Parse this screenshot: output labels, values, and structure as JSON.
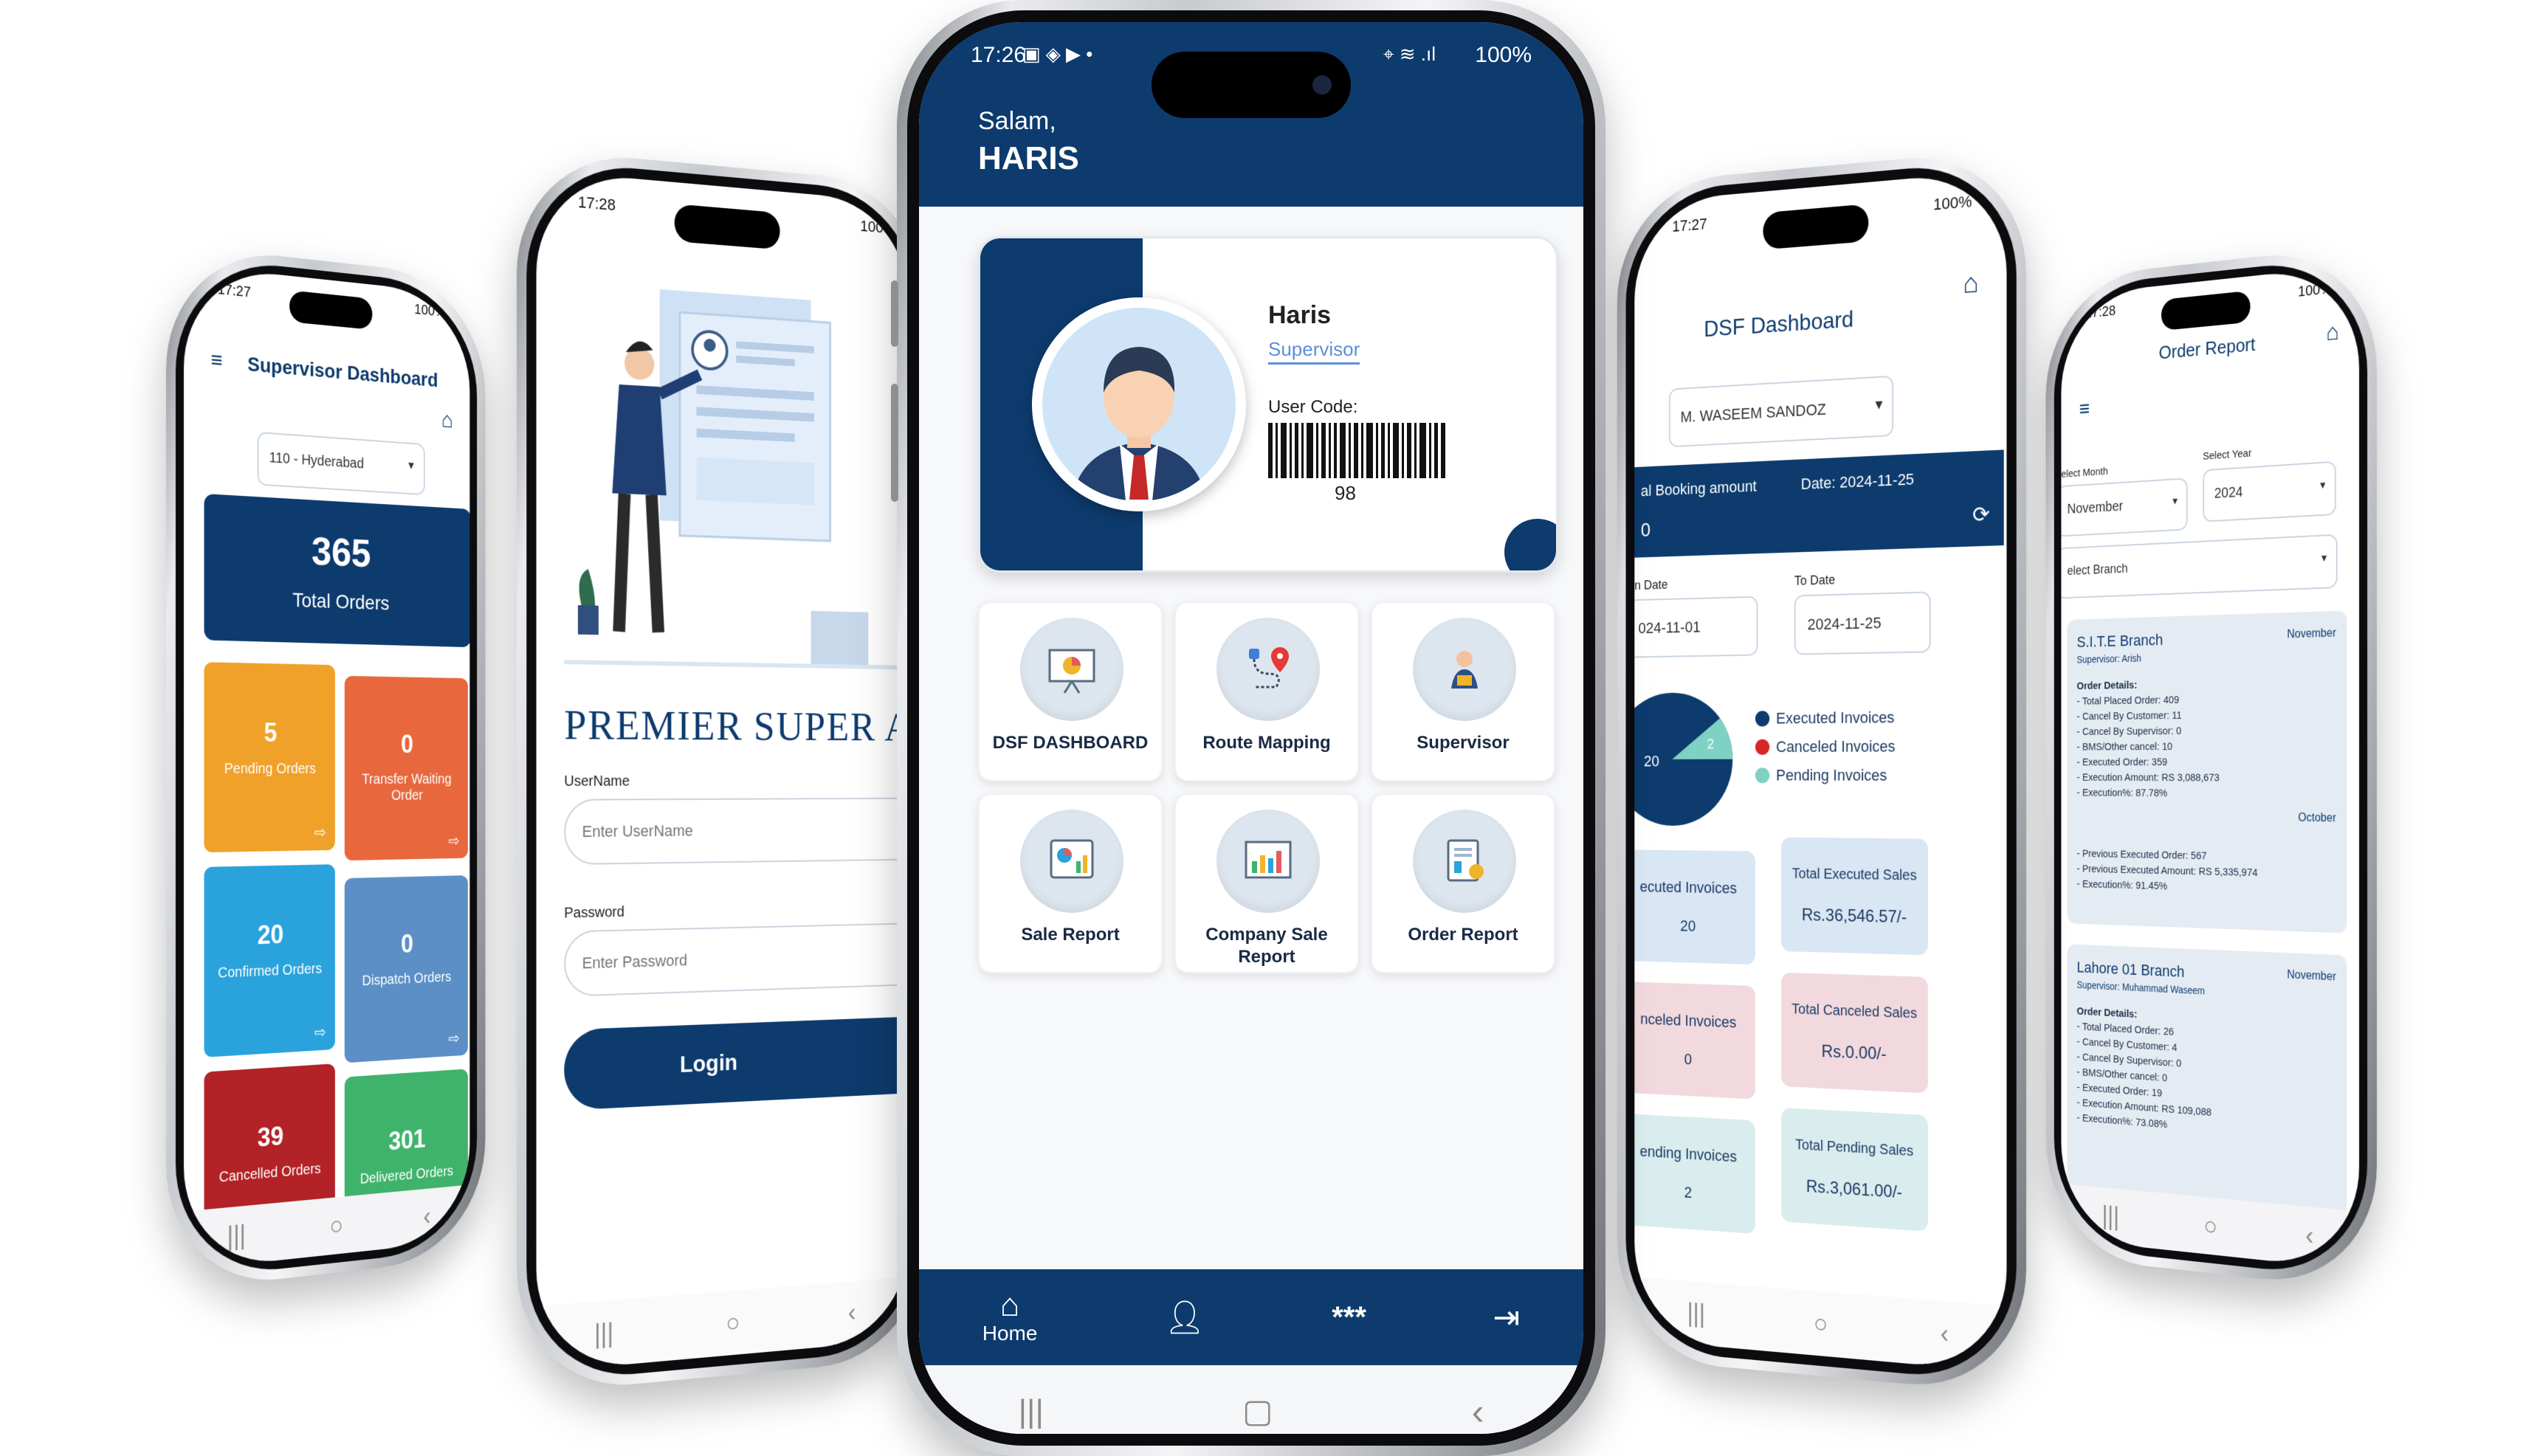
{
  "center": {
    "status": {
      "time": "17:26",
      "battery": "100%"
    },
    "greeting": "Salam,",
    "user_name": "HARIS",
    "profile": {
      "name": "Haris",
      "role": "Supervisor",
      "code_label": "User Code:",
      "code": "98"
    },
    "menu": [
      {
        "label": "DSF DASHBOARD"
      },
      {
        "label": "Route Mapping"
      },
      {
        "label": "Supervisor"
      },
      {
        "label": "Sale Report"
      },
      {
        "label": "Company Sale Report"
      },
      {
        "label": "Order Report"
      }
    ],
    "bottom_nav": {
      "home": "Home"
    }
  },
  "login": {
    "status": {
      "time": "17:28",
      "battery": "100"
    },
    "brand": "PREMIER SUPER AI",
    "username_label": "UserName",
    "username_placeholder": "Enter UserName",
    "password_label": "Password",
    "password_placeholder": "Enter Password",
    "login_button": "Login"
  },
  "supervisor": {
    "status": {
      "time": "17:27",
      "battery": "100%"
    },
    "title": "Supervisor Dashboard",
    "branch": "110 - Hyderabad",
    "total": {
      "value": "365",
      "label": "Total Orders"
    },
    "tiles": [
      {
        "value": "5",
        "label": "Pending Orders",
        "color": "#f0a12a"
      },
      {
        "value": "0",
        "label": "Transfer Waiting Order",
        "color": "#e8673d"
      },
      {
        "value": "20",
        "label": "Confirmed Orders",
        "color": "#2aa2dc"
      },
      {
        "value": "0",
        "label": "Dispatch Orders",
        "color": "#5b8fc6"
      },
      {
        "value": "39",
        "label": "Cancelled Orders",
        "color": "#b22226"
      },
      {
        "value": "301",
        "label": "Delivered Orders",
        "color": "#3fb36b"
      }
    ]
  },
  "dsf": {
    "status": {
      "time": "17:27",
      "battery": "100%"
    },
    "title": "DSF Dashboard",
    "salesman": "M. WASEEM SANDOZ",
    "booking_label": "al Booking amount",
    "booking_value": "0",
    "date_label": "Date: 2024-11-25",
    "from_label": "n Date",
    "from_value": "024-11-01",
    "to_label": "To Date",
    "to_value": "2024-11-25",
    "pie": {
      "value_left": "20",
      "value_right": "2"
    },
    "legend": [
      {
        "label": "Executed Invoices",
        "color": "#0d3b6e"
      },
      {
        "label": "Canceled Invoices",
        "color": "#d62828"
      },
      {
        "label": "Pending Invoices",
        "color": "#7fd1c4"
      }
    ],
    "stats": [
      {
        "left_label": "ecuted Invoices",
        "left_value": "20",
        "right_label": "Total Executed Sales",
        "right_value": "Rs.36,546.57/-",
        "color": "#d9e6f4"
      },
      {
        "left_label": "nceled Invoices",
        "left_value": "0",
        "right_label": "Total Canceled Sales",
        "right_value": "Rs.0.00/-",
        "color": "#f1d9de"
      },
      {
        "left_label": "ending Invoices",
        "left_value": "2",
        "right_label": "Total Pending Sales",
        "right_value": "Rs.3,061.00/-",
        "color": "#d9ecee"
      }
    ]
  },
  "order_report": {
    "status": {
      "time": "17:28",
      "battery": "100%"
    },
    "title": "Order Report",
    "month_label": "elect Month",
    "month_value": "November",
    "year_label": "Select Year",
    "year_value": "2024",
    "branch_label": "elect Branch",
    "branches": [
      {
        "name": "S.I.T.E Branch",
        "supervisor": "Supervisor: Arish",
        "month": "November",
        "details_title": "Order Details:",
        "lines": [
          "- Total Placed Order: 409",
          "- Cancel By Customer: 11",
          "- Cancel By Supervisor: 0",
          "- BMS/Other cancel: 10",
          "- Executed Order: 359",
          "- Execution Amount: RS 3,088,673",
          "- Execution%: 87.78%"
        ],
        "prev_month": "October",
        "prev_lines": [
          "- Previous Executed Order: 567",
          "- Previous Executed Amount: RS 5,335,974",
          "- Execution%: 91.45%"
        ]
      },
      {
        "name": "Lahore 01 Branch",
        "supervisor": "Supervisor: Muhammad Waseem",
        "month": "November",
        "details_title": "Order Details:",
        "lines": [
          "- Total Placed Order: 26",
          "- Cancel By Customer: 4",
          "- Cancel By Supervisor: 0",
          "- BMS/Other cancel: 0",
          "- Executed Order: 19",
          "- Execution Amount: RS 109,088",
          "- Execution%: 73.08%"
        ]
      }
    ]
  }
}
